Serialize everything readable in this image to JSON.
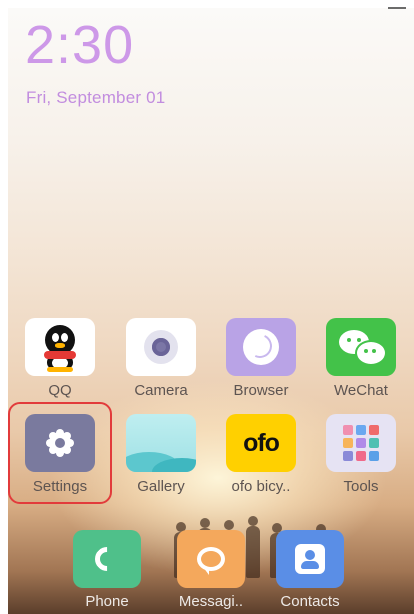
{
  "status": {
    "time": "2:30",
    "date": "Fri, September 01"
  },
  "apps": {
    "row1": [
      {
        "label": "QQ",
        "icon": "qq-penguin-icon"
      },
      {
        "label": "Camera",
        "icon": "camera-icon"
      },
      {
        "label": "Browser",
        "icon": "browser-icon"
      },
      {
        "label": "WeChat",
        "icon": "wechat-icon"
      }
    ],
    "row2": [
      {
        "label": "Settings",
        "icon": "gear-icon"
      },
      {
        "label": "Gallery",
        "icon": "gallery-icon"
      },
      {
        "label": "ofo bicy..",
        "icon": "ofo-icon",
        "icon_text": "ofo"
      },
      {
        "label": "Tools",
        "icon": "tools-grid-icon"
      }
    ]
  },
  "dock": [
    {
      "label": "Phone",
      "icon": "phone-icon"
    },
    {
      "label": "Messagi..",
      "icon": "message-bubble-icon"
    },
    {
      "label": "Contacts",
      "icon": "contact-card-icon"
    }
  ],
  "colors": {
    "clock": "#cd98e8",
    "highlight": "#e23b3b",
    "browser": "#b9a3e6",
    "wechat": "#43c249",
    "settings": "#7a7a9e",
    "ofo": "#ffd000",
    "phone": "#4fc08a",
    "messages": "#f4a85c",
    "contacts": "#5a8ee6"
  }
}
